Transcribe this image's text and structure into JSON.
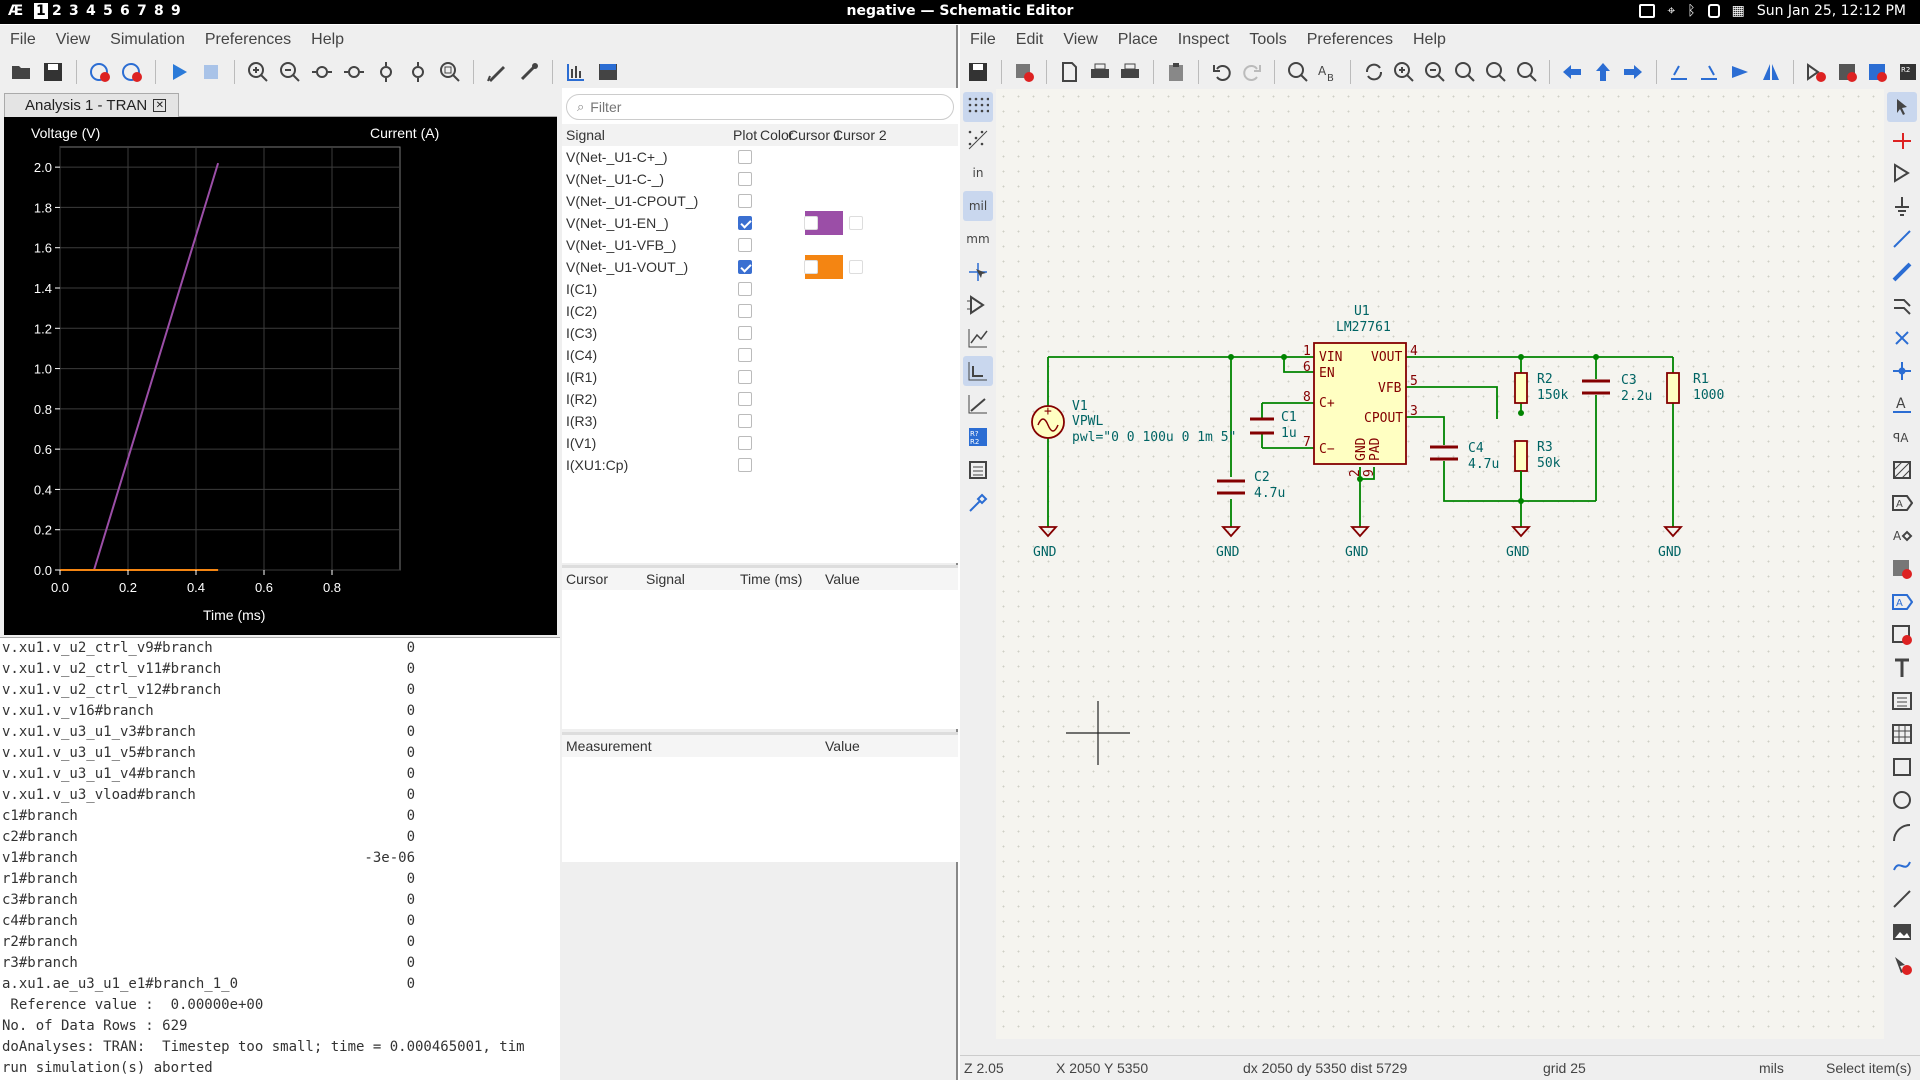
{
  "topbar": {
    "logo": "Æ",
    "workspaces": [
      "1",
      "2",
      "3",
      "4",
      "5",
      "6",
      "7",
      "8",
      "9"
    ],
    "title": "negative — Schematic Editor",
    "datetime": "Sun Jan 25, 12:12 PM"
  },
  "sim": {
    "menu": [
      "File",
      "View",
      "Simulation",
      "Preferences",
      "Help"
    ],
    "tab_label": "Analysis 1 - TRAN",
    "filter_placeholder": "Filter",
    "signal_headers": {
      "signal": "Signal",
      "plot": "Plot",
      "color": "Color",
      "cursor1": "Cursor 1",
      "cursor2": "Cursor 2"
    },
    "signals": [
      {
        "name": "V(Net-_U1-C+_)",
        "plot": false
      },
      {
        "name": "V(Net-_U1-C-_)",
        "plot": false
      },
      {
        "name": "V(Net-_U1-CPOUT_)",
        "plot": false
      },
      {
        "name": "V(Net-_U1-EN_)",
        "plot": true,
        "color": "#9b4ea7"
      },
      {
        "name": "V(Net-_U1-VFB_)",
        "plot": false
      },
      {
        "name": "V(Net-_U1-VOUT_)",
        "plot": true,
        "color": "#f48512"
      },
      {
        "name": "I(C1)",
        "plot": false
      },
      {
        "name": "I(C2)",
        "plot": false
      },
      {
        "name": "I(C3)",
        "plot": false
      },
      {
        "name": "I(C4)",
        "plot": false
      },
      {
        "name": "I(R1)",
        "plot": false
      },
      {
        "name": "I(R2)",
        "plot": false
      },
      {
        "name": "I(R3)",
        "plot": false
      },
      {
        "name": "I(V1)",
        "plot": false
      },
      {
        "name": "I(XU1:Cp)",
        "plot": false
      }
    ],
    "cursor_headers": {
      "cursor": "Cursor",
      "signal": "Signal",
      "time": "Time (ms)",
      "value": "Value"
    },
    "measurement_headers": {
      "measurement": "Measurement",
      "value": "Value"
    },
    "console_lines": [
      {
        "name": "v.xu1.v_u2_ctrl_v9#branch",
        "value": "0"
      },
      {
        "name": "v.xu1.v_u2_ctrl_v11#branch",
        "value": "0"
      },
      {
        "name": "v.xu1.v_u2_ctrl_v12#branch",
        "value": "0"
      },
      {
        "name": "v.xu1.v_v16#branch",
        "value": "0"
      },
      {
        "name": "v.xu1.v_u3_u1_v3#branch",
        "value": "0"
      },
      {
        "name": "v.xu1.v_u3_u1_v5#branch",
        "value": "0"
      },
      {
        "name": "v.xu1.v_u3_u1_v4#branch",
        "value": "0"
      },
      {
        "name": "v.xu1.v_u3_vload#branch",
        "value": "0"
      },
      {
        "name": "c1#branch",
        "value": "0"
      },
      {
        "name": "c2#branch",
        "value": "0"
      },
      {
        "name": "v1#branch",
        "value": "-3e-06"
      },
      {
        "name": "r1#branch",
        "value": "0"
      },
      {
        "name": "c3#branch",
        "value": "0"
      },
      {
        "name": "c4#branch",
        "value": "0"
      },
      {
        "name": "r2#branch",
        "value": "0"
      },
      {
        "name": "r3#branch",
        "value": "0"
      },
      {
        "name": "a.xu1.ae_u3_u1_e1#branch_1_0",
        "value": "0"
      },
      {
        "name": " Reference value :  0.00000e+00",
        "value": ""
      },
      {
        "name": "No. of Data Rows : 629",
        "value": ""
      },
      {
        "name": "doAnalyses: TRAN:  Timestep too small; time = 0.000465001, tim",
        "value": ""
      },
      {
        "name": "run simulation(s) aborted",
        "value": ""
      }
    ]
  },
  "chart_data": {
    "type": "line",
    "ylabel": "Voltage (V)",
    "y2label": "Current (A)",
    "xlabel": "Time (ms)",
    "xlim": [
      0,
      1.0
    ],
    "ylim": [
      0,
      2.1
    ],
    "xticks": [
      "0.0",
      "0.2",
      "0.4",
      "0.6",
      "0.8"
    ],
    "yticks": [
      "0.0",
      "0.2",
      "0.4",
      "0.6",
      "0.8",
      "1.0",
      "1.2",
      "1.4",
      "1.6",
      "1.8",
      "2.0"
    ],
    "grid": true,
    "series": [
      {
        "name": "V(Net-_U1-EN_)",
        "color": "#9b4ea7",
        "x": [
          0,
          0.1,
          0.465
        ],
        "y": [
          0,
          0,
          2.02
        ]
      },
      {
        "name": "V(Net-_U1-VOUT_)",
        "color": "#f48512",
        "x": [
          0,
          0.465
        ],
        "y": [
          0,
          0
        ]
      }
    ]
  },
  "sch": {
    "menu": [
      "File",
      "Edit",
      "View",
      "Place",
      "Inspect",
      "Tools",
      "Preferences",
      "Help"
    ],
    "units_labels": {
      "in": "in",
      "mil": "mil",
      "mm": "mm"
    },
    "u1": {
      "ref": "U1",
      "value": "LM27761",
      "pins_left": [
        "VIN",
        "EN",
        "C+",
        "C−"
      ],
      "pins_right": [
        "VOUT",
        "VFB",
        "CPOUT"
      ],
      "bottom_pins": [
        "GND",
        "PAD"
      ],
      "pin_numbers": [
        "1",
        "6",
        "8",
        "7",
        "4",
        "5",
        "3",
        "2",
        "9"
      ]
    },
    "v1": {
      "ref": "V1",
      "value": "VPWL",
      "spec": "pwl=\"0 0 100u 0 1m 5\""
    },
    "c1": {
      "ref": "C1",
      "value": "1u"
    },
    "c2": {
      "ref": "C2",
      "value": "4.7u"
    },
    "c3": {
      "ref": "C3",
      "value": "2.2u"
    },
    "c4": {
      "ref": "C4",
      "value": "4.7u"
    },
    "r1": {
      "ref": "R1",
      "value": "1000"
    },
    "r2": {
      "ref": "R2",
      "value": "150k"
    },
    "r3": {
      "ref": "R3",
      "value": "50k"
    },
    "gnd_label": "GND",
    "status": {
      "zoom": "Z 2.05",
      "xy": "X 2050  Y 5350",
      "dist": "dx 2050  dy 5350  dist 5729",
      "grid": "grid 25",
      "units": "mils",
      "mode": "Select item(s)"
    }
  }
}
